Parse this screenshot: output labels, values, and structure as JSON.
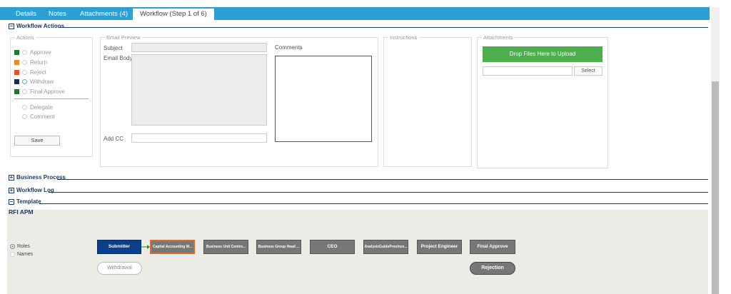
{
  "tabs": [
    {
      "label": "Details"
    },
    {
      "label": "Notes"
    },
    {
      "label": "Attachments (4)"
    },
    {
      "label": "Workflow (Step 1 of 6)"
    }
  ],
  "sections": {
    "workflow_actions": "Workflow Actions",
    "business_process": "Business Process",
    "workflow_log": "Workflow Log",
    "template": "Template"
  },
  "actions": {
    "legend": "Actions",
    "items": [
      {
        "label": "Approve",
        "color": "#1e7a2e"
      },
      {
        "label": "Return",
        "color": "#e58a2e"
      },
      {
        "label": "Reject",
        "color": "#e0552e"
      },
      {
        "label": "Withdraw",
        "color": "#1a2a55"
      },
      {
        "label": "Final Approve",
        "color": "#1e7a2e"
      }
    ],
    "extra": [
      {
        "label": "Delegate"
      },
      {
        "label": "Comment"
      }
    ],
    "save_label": "Save"
  },
  "email_preview": {
    "legend": "Email Preview",
    "subject_label": "Subject",
    "body_label": "Email Body",
    "addcc_label": "Add CC",
    "comments_label": "Comments"
  },
  "instructions": {
    "legend": "Instructions"
  },
  "attachments": {
    "legend": "Attachments",
    "upload_label": "Drop Files Here to Upload",
    "select_label": "Select"
  },
  "rfi": {
    "title": "RFI APM",
    "options": [
      {
        "label": "Roles",
        "selected": true
      },
      {
        "label": "Names",
        "selected": false
      }
    ],
    "steps": [
      {
        "label": "Submitter"
      },
      {
        "label": "Capital Accounting M..."
      },
      {
        "label": "Business Unit Contro..."
      },
      {
        "label": "Business Group Head ..."
      },
      {
        "label": "CEO"
      },
      {
        "label": "AnalysisGuideProvince..."
      },
      {
        "label": "Project Engineer"
      },
      {
        "label": "Final Approve"
      }
    ],
    "withdrawal_label": "Withdrawal",
    "rejection_label": "Rejection"
  }
}
